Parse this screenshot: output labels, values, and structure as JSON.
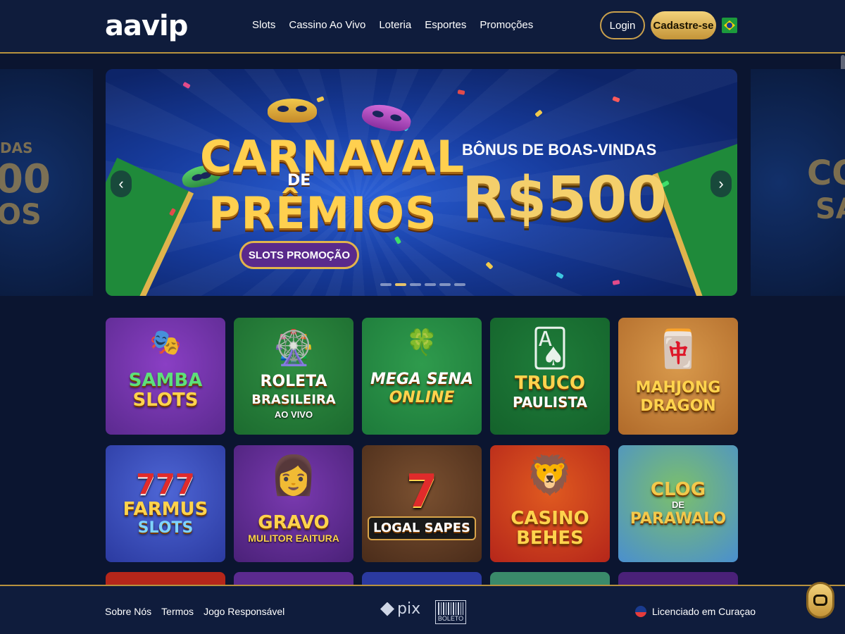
{
  "header": {
    "logo": "aavip",
    "nav": [
      "Slots",
      "Cassino Ao Vivo",
      "Loteria",
      "Esportes",
      "Promoções"
    ],
    "login_label": "Login",
    "register_label": "Cadastre-se",
    "flag_icon": "brazil-flag-icon"
  },
  "carousel": {
    "side_left_text": [
      "DAS",
      "00",
      "OS"
    ],
    "side_right_text": [
      "CO",
      "SA"
    ],
    "title_carnaval": "CARNAVAL",
    "title_de": "DE",
    "title_premios": "PRÊMIOS",
    "pill": "SLOTS PROMOÇÃO",
    "bonus_label": "BÔNUS DE BOAS-VINDAS",
    "bonus_amount": "R$500",
    "prev_icon": "‹",
    "next_icon": "›",
    "dots_count": 6,
    "active_dot": 1
  },
  "games": [
    {
      "line1": "SAMBA",
      "line2": "SLOTS",
      "line3": "",
      "art": "🎭",
      "bg": "#5b2a8f",
      "accent": "#8a3fc4"
    },
    {
      "line1": "ROLETA",
      "line2": "BRASILEIRA",
      "line3": "AO VIVO",
      "art": "🎡",
      "bg": "#1c6b2f",
      "accent": "#2f8d42"
    },
    {
      "line1": "MEGA SENA",
      "line2": "ONLINE",
      "line3": "",
      "art": "🍀",
      "bg": "#1d7a3a",
      "accent": "#2f9b4d"
    },
    {
      "line1": "TRUCO",
      "line2": "PAULISTA",
      "line3": "",
      "art": "🂡",
      "bg": "#14622b",
      "accent": "#1f7d3a"
    },
    {
      "line1": "MAHJONG",
      "line2": "DRAGON",
      "line3": "",
      "art": "🀄",
      "bg": "#b06a2a",
      "accent": "#d99a4c"
    },
    {
      "line1": "777",
      "line2": "FARMUS",
      "line3": "SLOTS",
      "art": "",
      "bg": "#2b3aa0",
      "accent": "#4e66d6"
    },
    {
      "line1": "GRAVO",
      "line2": "MULITOR EAITURA",
      "line3": "",
      "art": "👩",
      "bg": "#4a2178",
      "accent": "#7a3ab0"
    },
    {
      "line1": "7",
      "line2": "LOGAL SAPES",
      "line3": "",
      "art": "",
      "bg": "#4a2c1a",
      "accent": "#7a5030"
    },
    {
      "line1": "CASINO",
      "line2": "BEHES",
      "line3": "",
      "art": "🦁",
      "bg": "#b5261a",
      "accent": "#e05a20"
    },
    {
      "line1": "CLOG",
      "line2": "DE",
      "line3": "PARAWALO",
      "art": "",
      "bg": "#4a8fcf",
      "accent": "#7cc06a"
    }
  ],
  "footer": {
    "links": [
      "Sobre Nós",
      "Termos",
      "Jogo Responsável"
    ],
    "pix_label": "pix",
    "boleto_label": "BOLETO",
    "license_text": "Licenciado em Curaçao",
    "chat_icon": "chat-icon"
  },
  "colors": {
    "background": "#0b1530",
    "header": "#0f1c3c",
    "gold": "#c9a04c",
    "banner_blue": "#173c9e"
  }
}
